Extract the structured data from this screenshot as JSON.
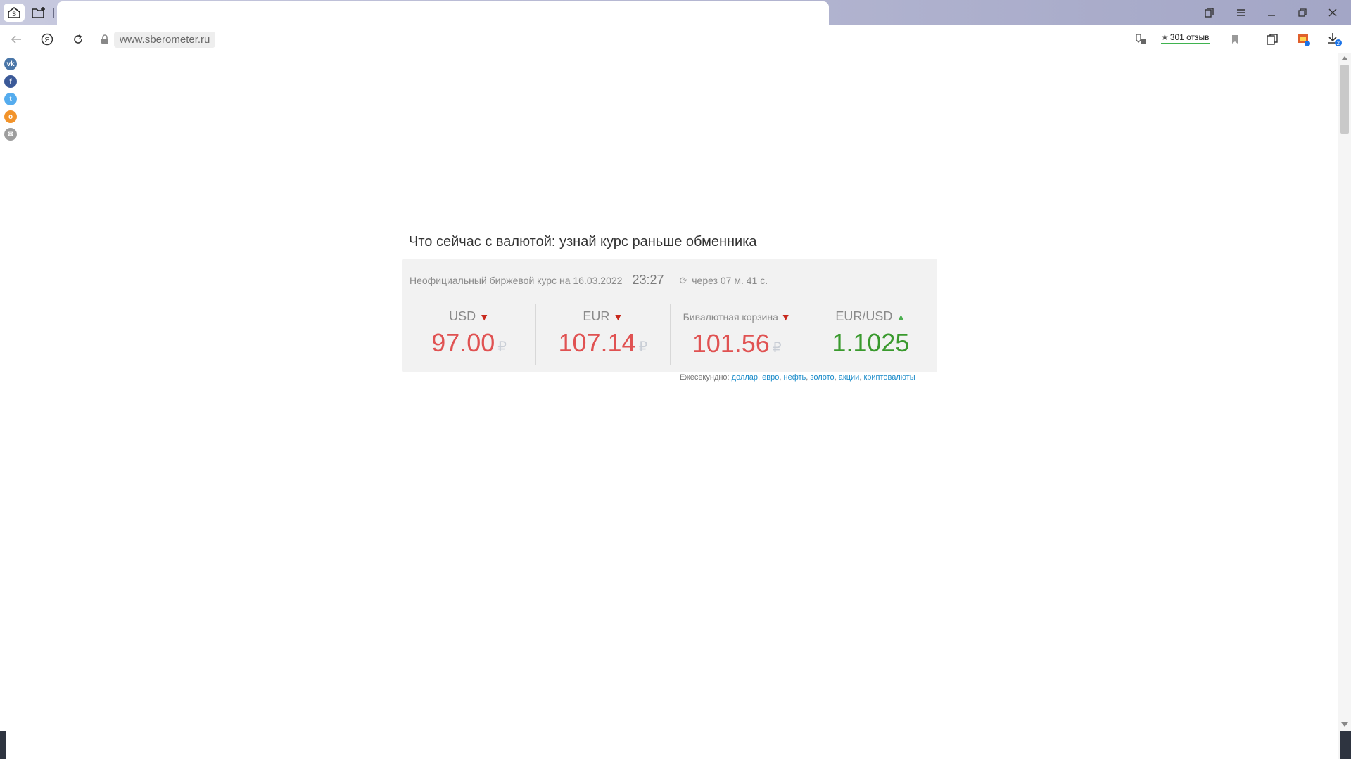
{
  "browser": {
    "url": "www.sberometer.ru",
    "reviews_label": "301 отзыв",
    "downloads_badge": "2",
    "icons": [
      "home-tab-icon",
      "new-tab-icon",
      "back-icon",
      "yandex-icon",
      "reload-icon",
      "lock-icon",
      "protect-icon",
      "bookmark-icon",
      "collections-icon",
      "extension-icon",
      "download-icon",
      "tabs-icon",
      "menu-icon",
      "minimize-icon",
      "restore-icon",
      "close-icon"
    ]
  },
  "share": {
    "items": [
      "vk",
      "facebook",
      "twitter",
      "odnoklassniki",
      "email"
    ],
    "colors": {
      "vk": "#4a76a8",
      "facebook": "#3b5998",
      "twitter": "#55acee",
      "odnoklassniki": "#f2932a",
      "email": "#9e9e9e"
    }
  },
  "widget": {
    "heading": "Что сейчас с валютой: узнай курс раньше обменника",
    "subtitle": "Неофициальный биржевой курс на 16.03.2022",
    "time": "23:27",
    "countdown": "через 07 м. 41 с.",
    "rates": [
      {
        "label": "USD",
        "value": "97.00",
        "trend": "down",
        "currency": "₽"
      },
      {
        "label": "EUR",
        "value": "107.14",
        "trend": "down",
        "currency": "₽"
      },
      {
        "label": "Бивалютная корзина",
        "value": "101.56",
        "trend": "down",
        "currency": "₽"
      },
      {
        "label": "EUR/USD",
        "value": "1.1025",
        "trend": "up",
        "currency": ""
      }
    ],
    "footer": {
      "prefix": "Ежесекундно:",
      "links": [
        "доллар",
        "евро",
        "нефть",
        "золото",
        "акции",
        "криптовалюты"
      ]
    },
    "colors": {
      "down": "#e05252",
      "up": "#3a9a2e",
      "link": "#1a8bc9"
    }
  }
}
